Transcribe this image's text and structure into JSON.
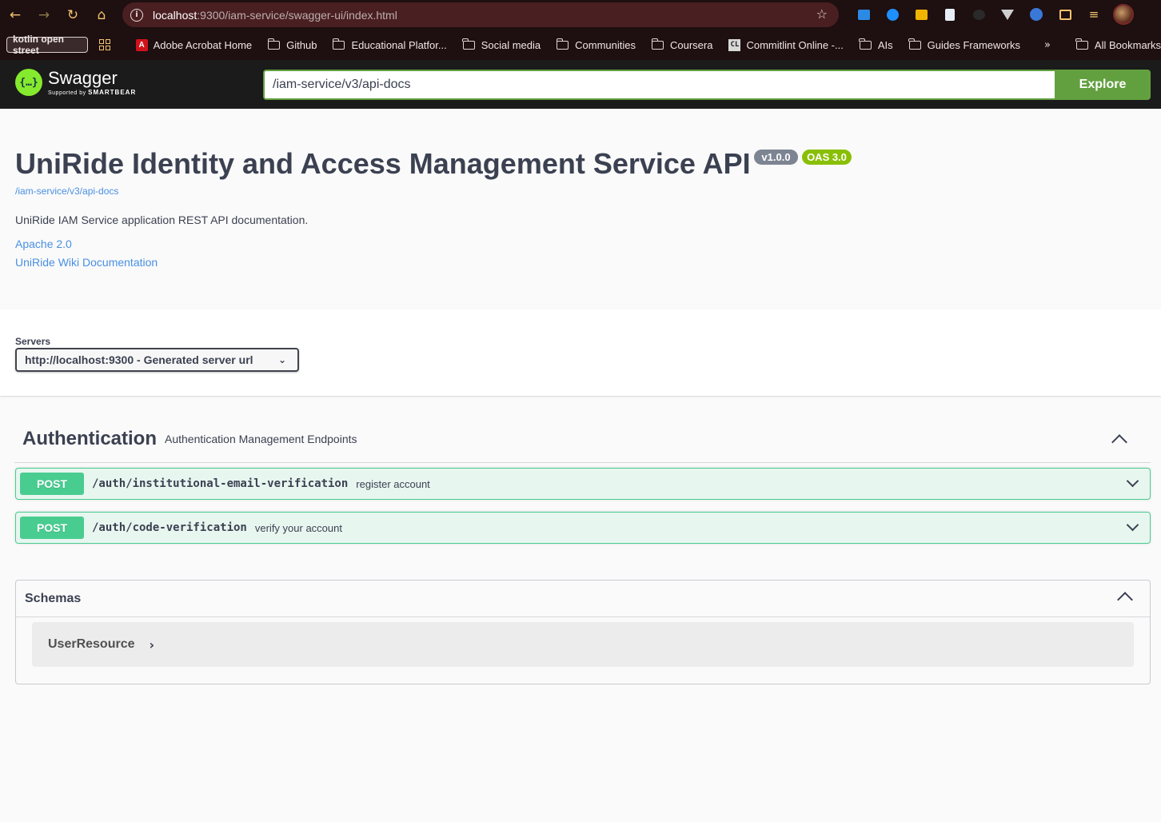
{
  "browser": {
    "url_host": "localhost",
    "url_rest": ":9300/iam-service/swagger-ui/index.html",
    "colors": {
      "chrome_bg": "#1e0f10",
      "omnibox_bg": "#4a1f22",
      "icon_yellow": "#f2c46e"
    }
  },
  "bookmarks": {
    "pill": "kotlin open street",
    "items": [
      {
        "label": "Adobe Acrobat Home",
        "icon": "pdf-icon"
      },
      {
        "label": "Github",
        "icon": "folder-icon"
      },
      {
        "label": "Educational Platfor...",
        "icon": "folder-icon"
      },
      {
        "label": "Social media",
        "icon": "folder-icon"
      },
      {
        "label": "Communities",
        "icon": "folder-icon"
      },
      {
        "label": "Coursera",
        "icon": "folder-icon"
      },
      {
        "label": "Commitlint Online -...",
        "icon": "cl-icon"
      },
      {
        "label": "AIs",
        "icon": "folder-icon"
      },
      {
        "label": "Guides Frameworks",
        "icon": "folder-icon"
      }
    ],
    "more": "»",
    "all_bookmarks": "All Bookmarks"
  },
  "swagger": {
    "logo_mark": "{…}",
    "logo_name": "Swagger",
    "logo_sub_prefix": "Supported by",
    "logo_sub_brand": "SMARTBEAR",
    "spec_url": "/iam-service/v3/api-docs",
    "explore_label": "Explore",
    "colors": {
      "header_bg": "#1b1b1b",
      "green": "#62a03f",
      "logo_green": "#85ea2d"
    }
  },
  "info": {
    "title": "UniRide Identity and Access Management Service API",
    "version_badge": "v1.0.0",
    "oas_badge": "OAS 3.0",
    "spec_link": "/iam-service/v3/api-docs",
    "description": "UniRide IAM Service application REST API documentation.",
    "license_link": "Apache 2.0",
    "wiki_link": "UniRide Wiki Documentation"
  },
  "servers": {
    "label": "Servers",
    "selected": "http://localhost:9300 - Generated server url"
  },
  "tag": {
    "name": "Authentication",
    "description": "Authentication Management Endpoints",
    "operations": [
      {
        "method": "POST",
        "path": "/auth/institutional-email-verification",
        "summary": "register account"
      },
      {
        "method": "POST",
        "path": "/auth/code-verification",
        "summary": "verify your account"
      }
    ],
    "colors": {
      "post": "#49cc90",
      "post_bg": "#e8f6f0"
    }
  },
  "schemas": {
    "title": "Schemas",
    "models": [
      {
        "name": "UserResource"
      }
    ]
  }
}
